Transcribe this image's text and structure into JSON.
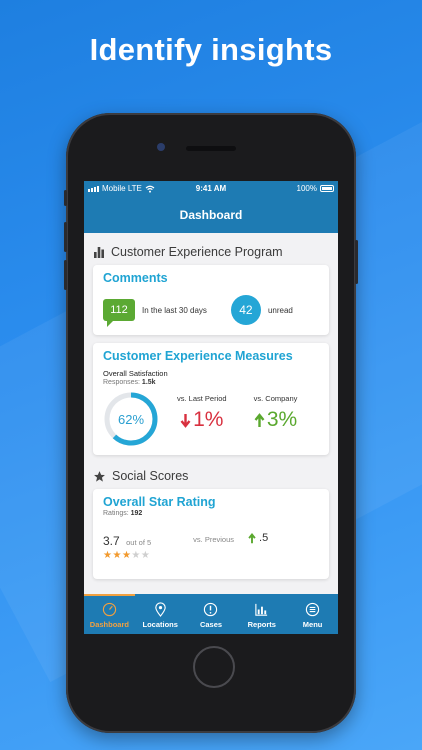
{
  "headline": "Identify insights",
  "status_bar": {
    "carrier": "Mobile",
    "network": "LTE",
    "time": "9:41 AM",
    "battery": "100%"
  },
  "nav": {
    "title": "Dashboard"
  },
  "cx_program": {
    "title": "Customer Experience Program",
    "icon": "bar-chart-icon"
  },
  "comments": {
    "title": "Comments",
    "count": "112",
    "count_label": "In the last 30 days",
    "unread_count": "42",
    "unread_label": "unread",
    "accent": "#5ba933",
    "unread_color": "#25a6d6"
  },
  "measures": {
    "title": "Customer Experience Measures",
    "metric": "Overall Satisfaction",
    "responses_label": "Responses:",
    "responses_value": "1.5k",
    "satisfaction_percent": 62,
    "satisfaction_label": "62%",
    "vs_last_period_label": "vs. Last Period",
    "vs_last_period_value": "1%",
    "vs_last_period_direction": "down",
    "vs_company_label": "vs. Company",
    "vs_company_value": "3%",
    "vs_company_direction": "up",
    "down_color": "#d8303f",
    "up_color": "#5aa82e"
  },
  "social": {
    "title": "Social Scores",
    "icon": "star-icon"
  },
  "star_rating": {
    "title": "Overall Star Rating",
    "ratings_label": "Ratings:",
    "ratings_value": "192",
    "score": "3.7",
    "out_of": "out of 5",
    "stars_rating": 3.7,
    "vs_previous_label": "vs. Previous",
    "vs_previous_value": ".5",
    "vs_previous_direction": "up"
  },
  "tabs": [
    {
      "label": "Dashboard",
      "icon": "speedometer-icon",
      "active": true
    },
    {
      "label": "Locations",
      "icon": "location-pin-icon",
      "active": false
    },
    {
      "label": "Cases",
      "icon": "alert-circle-icon",
      "active": false
    },
    {
      "label": "Reports",
      "icon": "reports-chart-icon",
      "active": false
    },
    {
      "label": "Menu",
      "icon": "menu-icon",
      "active": false
    }
  ]
}
